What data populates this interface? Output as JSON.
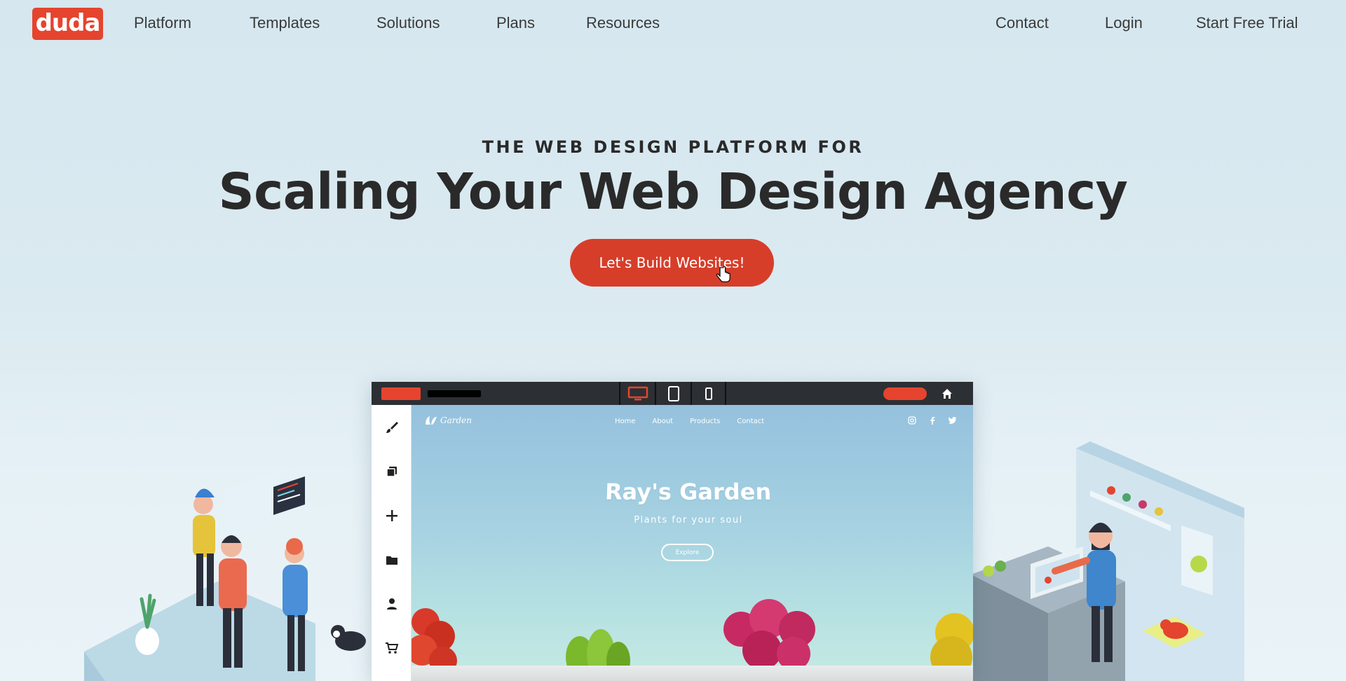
{
  "nav": {
    "logo": "duda",
    "left_links": [
      "Platform",
      "Templates",
      "Solutions",
      "Plans",
      "Resources"
    ],
    "right_links": [
      "Contact",
      "Login",
      "Start Free Trial"
    ]
  },
  "hero": {
    "kicker": "THE WEB DESIGN PLATFORM FOR",
    "headline": "Scaling Your Web Design Agency",
    "cta_label": "Let's Build Websites!"
  },
  "colors": {
    "brand_red": "#e5442e",
    "cta_red": "#d63e2a",
    "text_dark": "#2a2a2a",
    "editor_bar": "#2c2f33"
  },
  "editor": {
    "device_buttons": [
      "desktop-icon",
      "tablet-icon",
      "mobile-icon"
    ],
    "active_device": "desktop",
    "sidebar_tools": [
      "brush-icon",
      "pages-icon",
      "add-icon",
      "folder-icon",
      "user-icon",
      "cart-icon"
    ],
    "site": {
      "logo": "Garden",
      "nav": [
        "Home",
        "About",
        "Products",
        "Contact"
      ],
      "social": [
        "instagram-icon",
        "facebook-icon",
        "twitter-icon"
      ],
      "title": "Ray's Garden",
      "subtitle": "Plants for your soul",
      "button": "Explore"
    }
  }
}
